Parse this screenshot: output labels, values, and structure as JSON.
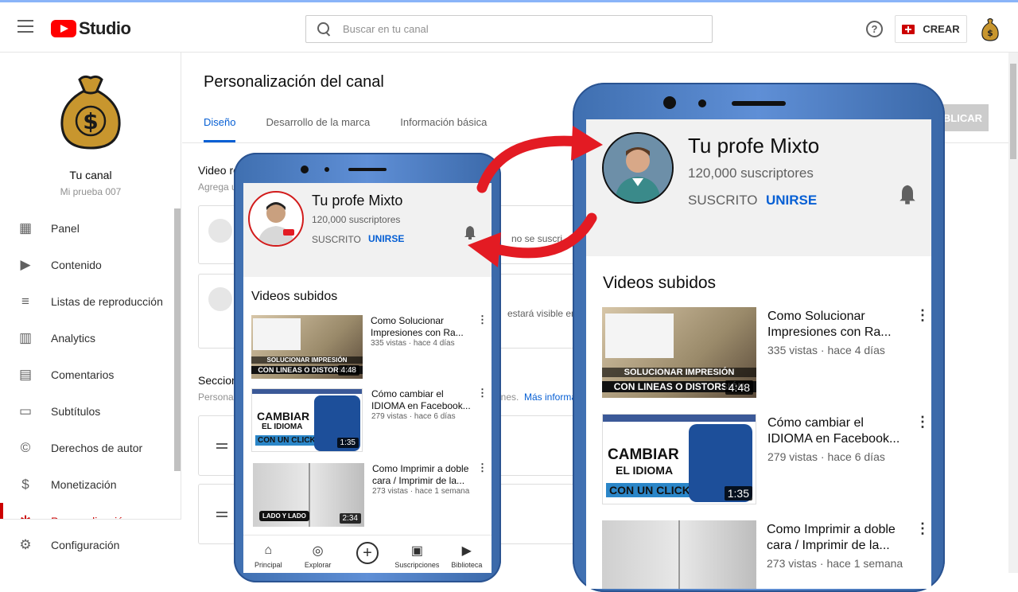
{
  "app": {
    "logo_text": "Studio"
  },
  "search": {
    "placeholder": "Buscar en tu canal"
  },
  "header": {
    "help_glyph": "?",
    "create_label": "CREAR"
  },
  "sidebar": {
    "channel_title": "Tu canal",
    "channel_sub": "Mi prueba 007",
    "items": [
      {
        "label": "Panel",
        "icon": "dashboard-icon"
      },
      {
        "label": "Contenido",
        "icon": "content-icon"
      },
      {
        "label": "Listas de reproducción",
        "icon": "playlist-icon"
      },
      {
        "label": "Analytics",
        "icon": "analytics-icon"
      },
      {
        "label": "Comentarios",
        "icon": "comments-icon"
      },
      {
        "label": "Subtítulos",
        "icon": "subtitles-icon"
      },
      {
        "label": "Derechos de autor",
        "icon": "copyright-icon"
      },
      {
        "label": "Monetización",
        "icon": "dollar-icon"
      },
      {
        "label": "Personalización",
        "icon": "customize-icon"
      }
    ],
    "settings_label": "Configuración"
  },
  "main": {
    "title": "Personalización del canal",
    "tabs": [
      {
        "label": "Diseño"
      },
      {
        "label": "Desarrollo de la marca"
      },
      {
        "label": "Información básica"
      }
    ],
    "publish_label": "BLICAR",
    "section1_title": "Video re",
    "section1_sub": "Agrega u",
    "card1_text": "no se suscri",
    "card2_text": "estará visible en",
    "section2_title": "Seccion",
    "section2_sub": "Personal",
    "section2_tail": "ones.",
    "section2_link": "Más informa"
  },
  "phone": {
    "channel_name": "Tu profe Mixto",
    "subscribers": "120,000 suscriptores",
    "subscribed": "SUSCRITO",
    "join": "UNIRSE",
    "videos_title": "Videos subidos",
    "videos": [
      {
        "title": "Como Solucionar Impresiones con Ra...",
        "meta": "335 vistas · hace 4 días",
        "duration": "4:48",
        "thumb_text1": "SOLUCIONAR IMPRESIÓN",
        "thumb_text2": "CON LINEAS O DISTORSIÓN"
      },
      {
        "title": "Cómo cambiar el IDIOMA en Facebook...",
        "meta": "279 vistas · hace 6 días",
        "duration": "1:35",
        "thumb_text1": "CAMBIAR",
        "thumb_text2": "EL IDIOMA",
        "thumb_text3": "CON UN CLICK"
      },
      {
        "title": "Como Imprimir a doble cara / Imprimir de la...",
        "meta": "273 vistas · hace 1 semana",
        "duration": "2:34",
        "thumb_text1": "LADO Y LADO"
      }
    ],
    "bottom_nav": [
      {
        "label": "Principal",
        "icon": "home-icon"
      },
      {
        "label": "Explorar",
        "icon": "compass-icon"
      },
      {
        "label": "",
        "icon": "add-icon"
      },
      {
        "label": "Suscripciones",
        "icon": "subscriptions-icon"
      },
      {
        "label": "Biblioteca",
        "icon": "library-icon"
      }
    ]
  },
  "colors": {
    "accent": "#065fd4",
    "brand": "#ff0000",
    "arrow": "#e31b23"
  }
}
